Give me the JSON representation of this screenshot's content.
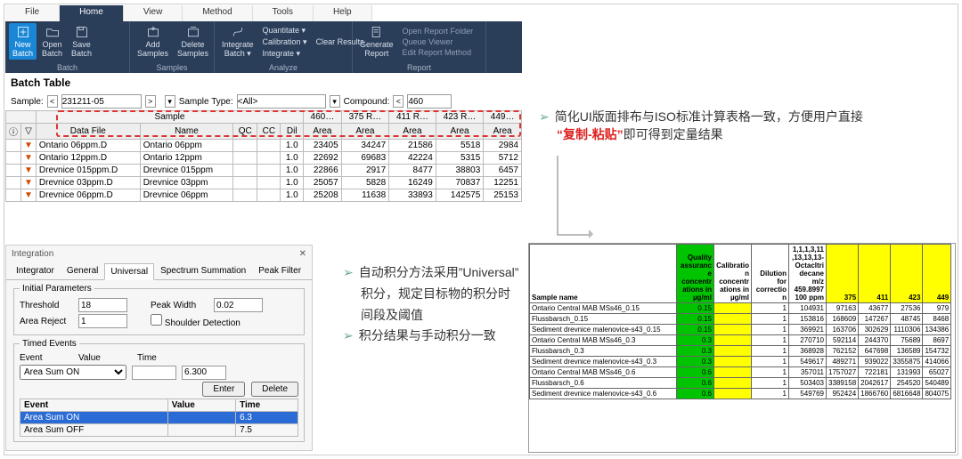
{
  "menu_tabs": [
    "File",
    "Home",
    "View",
    "Method",
    "Tools",
    "Help"
  ],
  "menu_active": 1,
  "ribbon": {
    "batch": {
      "new": "New\nBatch",
      "open": "Open\nBatch",
      "save": "Save\nBatch",
      "group": "Batch"
    },
    "samples": {
      "add": "Add\nSamples",
      "del": "Delete\nSamples",
      "group": "Samples"
    },
    "analyze": {
      "integrate": "Integrate\nBatch ▾",
      "quant": "Quantitate ▾",
      "clear": "Clear Results",
      "calib": "Calibration ▾",
      "integ": "Integrate ▾",
      "group": "Analyze"
    },
    "report": {
      "gen": "Generate\nReport",
      "open_folder": "Open Report Folder",
      "queue": "Queue Viewer",
      "edit": "Edit Report Method",
      "group": "Report"
    }
  },
  "batch_title": "Batch Table",
  "filter": {
    "sample_label": "Sample:",
    "sample_val": "231211-05",
    "type_label": "Sample Type:",
    "type_val": "<All>",
    "compound_label": "Compound:",
    "compound_val": "460"
  },
  "bt_group_sample": "Sample",
  "bt_group_cols": [
    "460…",
    "375  R…",
    "411  R…",
    "423  R…",
    "449…"
  ],
  "bt_headers": [
    "",
    "",
    "Data File",
    "Name",
    "QC",
    "CC",
    "Dil",
    "Area",
    "Area",
    "Area",
    "Area",
    "Area"
  ],
  "bt_rows": [
    {
      "file": "Ontario 06ppm.D",
      "name": "Ontario 06ppm",
      "dil": "1.0",
      "a": [
        "23405",
        "34247",
        "21586",
        "5518",
        "2984"
      ]
    },
    {
      "file": "Ontario 12ppm.D",
      "name": "Ontario 12ppm",
      "dil": "1.0",
      "a": [
        "22692",
        "69683",
        "42224",
        "5315",
        "5712"
      ]
    },
    {
      "file": "Drevnice 015ppm.D",
      "name": "Drevnice 015ppm",
      "dil": "1.0",
      "a": [
        "22866",
        "2917",
        "8477",
        "38803",
        "6457"
      ]
    },
    {
      "file": "Drevnice 03ppm.D",
      "name": "Drevnice 03ppm",
      "dil": "1.0",
      "a": [
        "25057",
        "5828",
        "16249",
        "70837",
        "12251"
      ]
    },
    {
      "file": "Drevnice 06ppm.D",
      "name": "Drevnice 06ppm",
      "dil": "1.0",
      "a": [
        "25208",
        "11638",
        "33893",
        "142575",
        "25153"
      ]
    }
  ],
  "integ": {
    "title": "Integration",
    "tabs": [
      "Integrator",
      "General",
      "Universal",
      "Spectrum Summation",
      "Peak Filter"
    ],
    "tab_active": 2,
    "init_legend": "Initial Parameters",
    "threshold_label": "Threshold",
    "threshold_val": "18",
    "peakwidth_label": "Peak Width",
    "peakwidth_val": "0.02",
    "areareject_label": "Area Reject",
    "areareject_val": "1",
    "shoulder_label": "Shoulder Detection",
    "timed_legend": "Timed Events",
    "ev_label": "Event",
    "val_label": "Value",
    "time_label": "Time",
    "sel_event": "Area Sum ON",
    "sel_time": "6.300",
    "enter": "Enter",
    "delete": "Delete",
    "rows": [
      {
        "ev": "Area Sum ON",
        "val": "",
        "time": "6.3",
        "sel": true
      },
      {
        "ev": "Area Sum OFF",
        "val": "",
        "time": "7.5",
        "sel": false
      }
    ]
  },
  "ann1": "简化UI版面排布与ISO标准计算表格一致，方便用户直接",
  "ann1b_red": "“复制-粘贴”",
  "ann1b_rest": "即可得到定量结果",
  "ann2a": "自动积分方法采用”Universal”",
  "ann2b": "积分，规定目标物的积分时",
  "ann2c": "间段及阈值",
  "ann3": "积分结果与手动积分一致",
  "sheet": {
    "head_sample": "Sample name",
    "head_cols": [
      {
        "t": "Quality assurance concentrations in µg/ml",
        "c": "green"
      },
      {
        "t": "Calibration concentrations in µg/ml",
        "c": "white"
      },
      {
        "t": "Dilution for correction",
        "c": "white"
      },
      {
        "t": "1,1,1,3,11,13,13,13-Octacltridecane m/z 459.8997 100 ppm",
        "c": "white"
      },
      {
        "t": "375",
        "c": "yellow"
      },
      {
        "t": "411",
        "c": "yellow"
      },
      {
        "t": "423",
        "c": "yellow"
      },
      {
        "t": "449",
        "c": "yellow"
      }
    ],
    "rows": [
      {
        "n": "Ontario Central MAB MSs46_0.15",
        "qa": "0.15",
        "cal": "",
        "dil": "1",
        "v": [
          "104931",
          "97163",
          "43677",
          "27536",
          "979"
        ]
      },
      {
        "n": "Flussbarsch_0.15",
        "qa": "0.15",
        "cal": "",
        "dil": "1",
        "v": [
          "153816",
          "168609",
          "147267",
          "48745",
          "8468"
        ]
      },
      {
        "n": "Sediment drevnice malenovice-s43_0.15",
        "qa": "0.15",
        "cal": "",
        "dil": "1",
        "v": [
          "369921",
          "163706",
          "302629",
          "1110306",
          "134386"
        ]
      },
      {
        "n": "Ontario Central MAB MSs46_0.3",
        "qa": "0.3",
        "cal": "",
        "dil": "1",
        "v": [
          "270710",
          "592114",
          "244370",
          "75689",
          "8697"
        ]
      },
      {
        "n": "Flussbarsch_0.3",
        "qa": "0.3",
        "cal": "",
        "dil": "1",
        "v": [
          "368928",
          "762152",
          "647698",
          "136589",
          "154732"
        ]
      },
      {
        "n": "Sediment drevnice malenovice-s43_0.3",
        "qa": "0.3",
        "cal": "",
        "dil": "1",
        "v": [
          "549617",
          "489271",
          "939022",
          "3355875",
          "414066"
        ]
      },
      {
        "n": "Ontario Central MAB MSs46_0.6",
        "qa": "0.6",
        "cal": "",
        "dil": "1",
        "v": [
          "357011",
          "1757027",
          "722181",
          "131993",
          "65027"
        ]
      },
      {
        "n": "Flussbarsch_0.6",
        "qa": "0.6",
        "cal": "",
        "dil": "1",
        "v": [
          "503403",
          "3389158",
          "2042617",
          "254520",
          "540489"
        ]
      },
      {
        "n": "Sediment drevnice malenovice-s43_0.6",
        "qa": "0.6",
        "cal": "",
        "dil": "1",
        "v": [
          "549769",
          "952424",
          "1866760",
          "6816648",
          "804075"
        ]
      }
    ]
  }
}
